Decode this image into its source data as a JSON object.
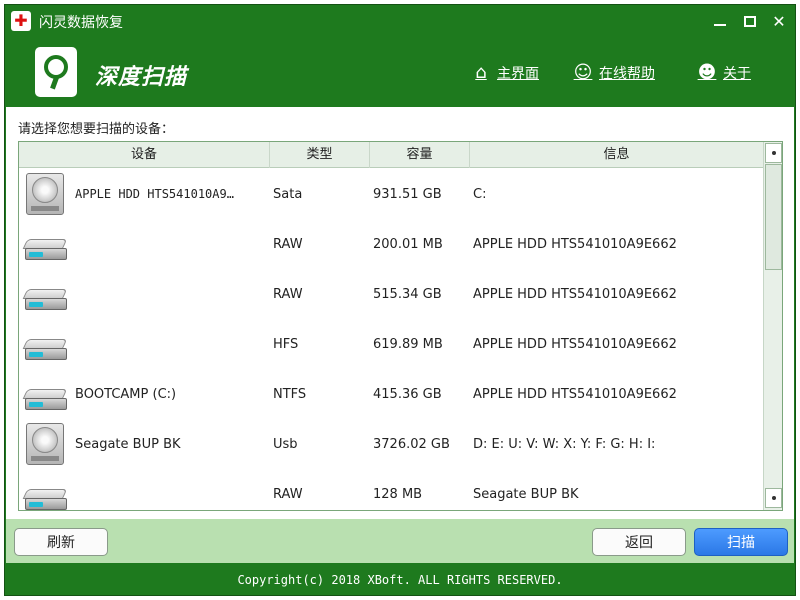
{
  "window": {
    "title": "闪灵数据恢复",
    "minimize_icon": "minimize-icon",
    "maximize_icon": "maximize-icon",
    "close_icon": "close-icon",
    "close_glyph": "✕"
  },
  "header": {
    "heading": "深度扫描",
    "nav": [
      {
        "label": "主界面",
        "icon": "home-icon"
      },
      {
        "label": "在线帮助",
        "icon": "user-help-icon"
      },
      {
        "label": "关于",
        "icon": "smiley-icon"
      }
    ]
  },
  "content": {
    "prompt": "请选择您想要扫描的设备："
  },
  "table": {
    "columns": [
      "设备",
      "类型",
      "容量",
      "信息"
    ],
    "rows": [
      {
        "icon": "hdd",
        "name": "APPLE HDD HTS541010A9…",
        "type": "Sata",
        "capacity": "931.51 GB",
        "info": "C:"
      },
      {
        "icon": "partition",
        "name": "",
        "type": "RAW",
        "capacity": "200.01 MB",
        "info": "APPLE HDD HTS541010A9E662"
      },
      {
        "icon": "partition",
        "name": "",
        "type": "RAW",
        "capacity": "515.34 GB",
        "info": "APPLE HDD HTS541010A9E662"
      },
      {
        "icon": "partition",
        "name": "",
        "type": "HFS",
        "capacity": "619.89 MB",
        "info": "APPLE HDD HTS541010A9E662"
      },
      {
        "icon": "partition",
        "name": "BOOTCAMP (C:)",
        "type": "NTFS",
        "capacity": "415.36 GB",
        "info": "APPLE HDD HTS541010A9E662"
      },
      {
        "icon": "hdd",
        "name": "Seagate BUP BK",
        "type": "Usb",
        "capacity": "3726.02 GB",
        "info": "D: E: U: V: W: X: Y: F: G: H: I:"
      },
      {
        "icon": "partition",
        "name": "",
        "type": "RAW",
        "capacity": "128 MB",
        "info": "Seagate BUP BK"
      }
    ]
  },
  "buttons": {
    "refresh": "刷新",
    "back": "返回",
    "scan": "扫描"
  },
  "footer": {
    "copyright": "Copyright(c) 2018 XBoft. ALL RIGHTS RESERVED."
  },
  "colors": {
    "brand_green": "#1e7a1e",
    "button_bar": "#b9e0b0",
    "scan_button": "#2b78e6"
  }
}
